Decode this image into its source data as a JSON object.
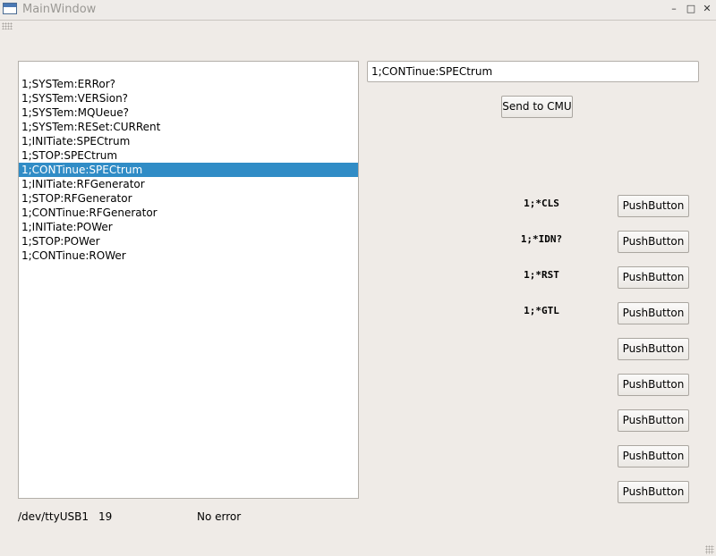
{
  "window": {
    "title": "MainWindow",
    "minimize": "–",
    "maximize": "□",
    "close": "✕"
  },
  "command_list": {
    "selected_index": 6,
    "items": [
      "1;SYSTem:ERRor?",
      "1;SYSTem:VERSion?",
      "1;SYSTem:MQUeue?",
      "1;SYSTem:RESet:CURRent",
      "1;INITiate:SPECtrum",
      "1;STOP:SPECtrum",
      "1;CONTinue:SPECtrum",
      "1;INITiate:RFGenerator",
      "1;STOP:RFGenerator",
      "1;CONTinue:RFGenerator",
      "1;INITiate:POWer",
      "1;STOP:POWer",
      "1;CONTinue:ROWer"
    ]
  },
  "command_input": {
    "value": "1;CONTinue:SPECtrum"
  },
  "send_button": {
    "label": "Send to CMU"
  },
  "labels": [
    "1;*CLS",
    "1;*IDN?",
    "1;*RST",
    "1;*GTL"
  ],
  "push_buttons": [
    "PushButton",
    "PushButton",
    "PushButton",
    "PushButton",
    "PushButton",
    "PushButton",
    "PushButton",
    "PushButton",
    "PushButton"
  ],
  "status": {
    "port": "/dev/ttyUSB1",
    "count": "19",
    "message": "No error"
  }
}
